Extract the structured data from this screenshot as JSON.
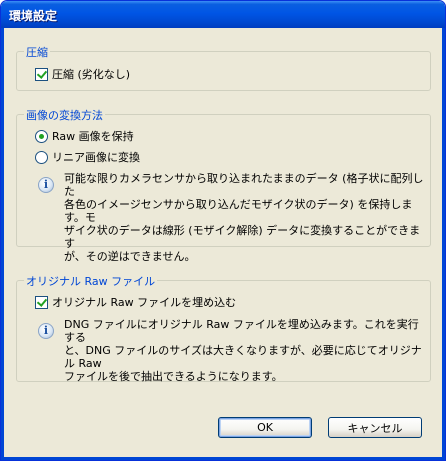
{
  "window": {
    "title": "環境設定"
  },
  "compression": {
    "legend": "圧縮",
    "checkbox_label": "圧縮 (劣化なし)",
    "checked": true
  },
  "conversion": {
    "legend": "画像の変換方法",
    "option_keep_raw": "Raw 画像を保持",
    "option_linear": "リニア画像に変換",
    "selected": "keep_raw",
    "info_lines": [
      "可能な限りカメラセンサから取り込まれたままのデータ (格子状に配列した",
      "各色のイメージセンサから取り込んだモザイク状のデータ) を保持します。モ",
      "ザイク状のデータは線形 (モザイク解除) データに変換することができます",
      "が、その逆はできません。"
    ]
  },
  "original_raw": {
    "legend": "オリジナル Raw ファイル",
    "checkbox_label": "オリジナル Raw ファイルを埋め込む",
    "checked": true,
    "info_lines": [
      "DNG ファイルにオリジナル Raw ファイルを埋め込みます。これを実行する",
      "と、DNG ファイルのサイズは大きくなりますが、必要に応じてオリジナル Raw",
      "ファイルを後で抽出できるようになります。"
    ]
  },
  "buttons": {
    "ok": "OK",
    "cancel": "キャンセル"
  },
  "icons": {
    "info": "info-icon"
  }
}
